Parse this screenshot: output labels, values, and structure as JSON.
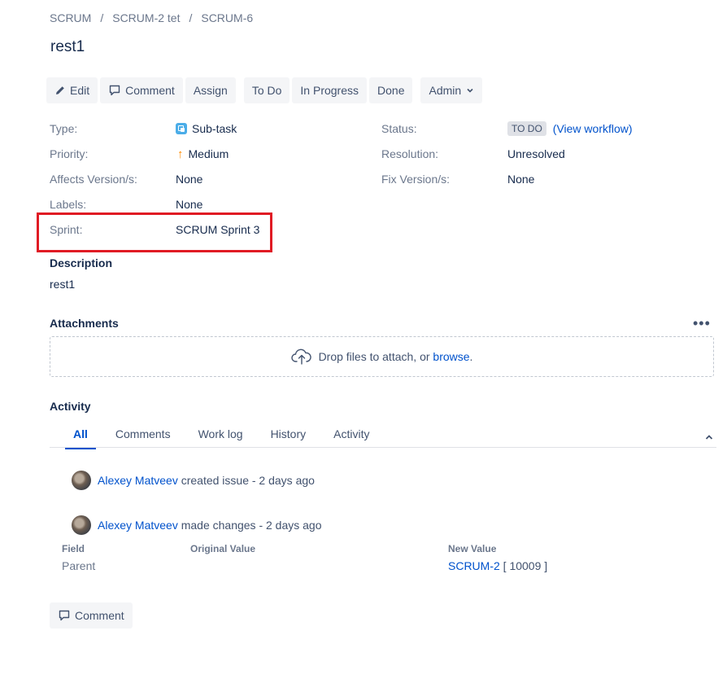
{
  "breadcrumb": [
    "SCRUM",
    "SCRUM-2 tet",
    "SCRUM-6"
  ],
  "breadcrumb_sep": "/",
  "issue": {
    "title": "rest1"
  },
  "toolbar": {
    "edit": "Edit",
    "comment": "Comment",
    "assign": "Assign",
    "todo": "To Do",
    "in_progress": "In Progress",
    "done": "Done",
    "admin": "Admin"
  },
  "details": {
    "type_label": "Type:",
    "type_value": "Sub-task",
    "priority_label": "Priority:",
    "priority_value": "Medium",
    "affects_label": "Affects Version/s:",
    "affects_value": "None",
    "labels_label": "Labels:",
    "labels_value": "None",
    "sprint_label": "Sprint:",
    "sprint_value": "SCRUM Sprint 3",
    "status_label": "Status:",
    "status_value": "TO DO",
    "view_workflow": "(View workflow)",
    "resolution_label": "Resolution:",
    "resolution_value": "Unresolved",
    "fix_label": "Fix Version/s:",
    "fix_value": "None"
  },
  "description": {
    "heading": "Description",
    "text": "rest1"
  },
  "attachments": {
    "heading": "Attachments",
    "more": "•••",
    "drop_text": "Drop files to attach, or ",
    "browse": "browse",
    "period": "."
  },
  "activity": {
    "heading": "Activity",
    "tabs": [
      "All",
      "Comments",
      "Work log",
      "History",
      "Activity"
    ],
    "entries": [
      {
        "user": "Alexey Matveev",
        "action": "created issue - 2 days ago"
      },
      {
        "user": "Alexey Matveev",
        "action": "made changes - 2 days ago"
      }
    ],
    "table": {
      "headers": [
        "Field",
        "Original Value",
        "New Value"
      ],
      "field": "Parent",
      "original": "",
      "new_link": "SCRUM-2",
      "new_rest": " [ 10009 ]"
    }
  },
  "comment_button": "Comment",
  "colors": {
    "link": "#0052cc",
    "highlight": "#e01b24",
    "priority": "#ff8b00"
  }
}
